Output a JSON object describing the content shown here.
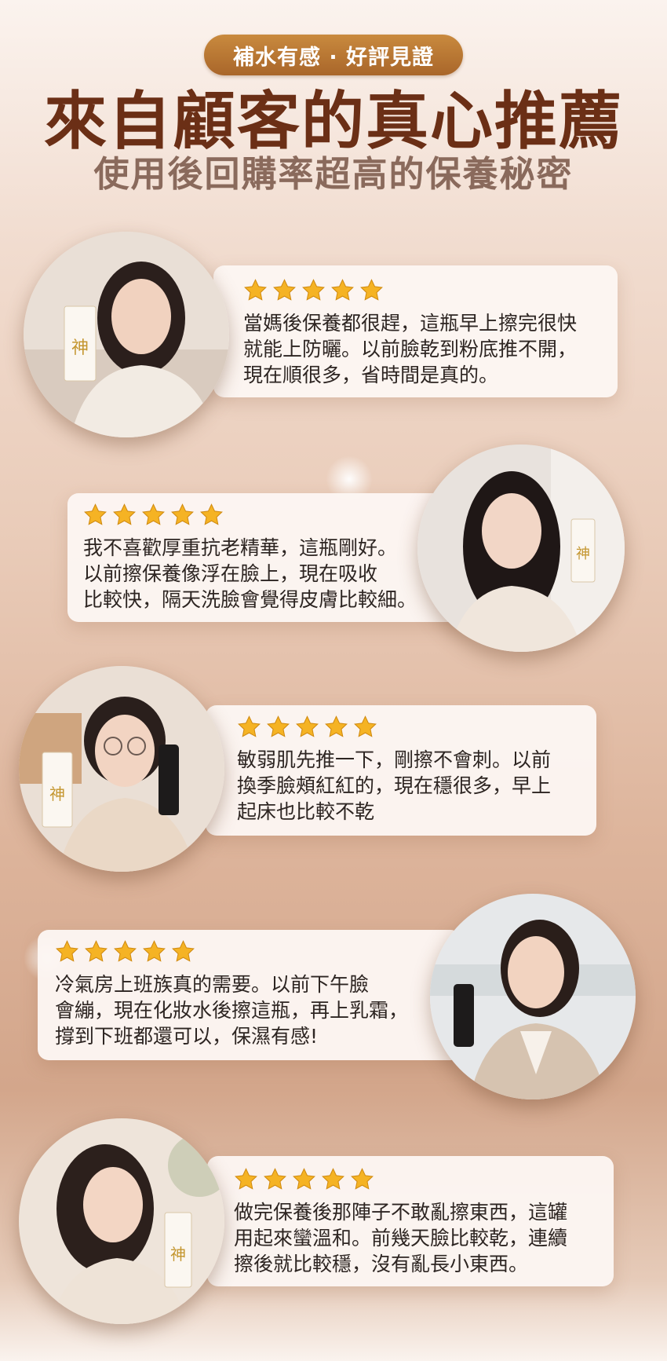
{
  "header": {
    "badge": "補水有感 · 好評見證",
    "title": "來自顧客的真心推薦",
    "subtitle": "使用後回購率超高的保養秘密"
  },
  "colors": {
    "badge_bg": "#b27534",
    "title": "#6b2f16",
    "subtitle": "#8a6a5c",
    "star": "#f5b324",
    "card_bg": "#fcf6f2"
  },
  "reviews": [
    {
      "rating": 5,
      "text": "當媽後保養都很趕，這瓶早上擦完很快\n就能上防曬。以前臉乾到粉底推不開，\n現在順很多，省時間是真的。",
      "avatar_icon": "customer-photo-1"
    },
    {
      "rating": 5,
      "text": "我不喜歡厚重抗老精華，這瓶剛好。\n以前擦保養像浮在臉上，現在吸收\n比較快，隔天洗臉會覺得皮膚比較細。",
      "avatar_icon": "customer-photo-2"
    },
    {
      "rating": 5,
      "text": "敏弱肌先推一下，剛擦不會刺。以前\n換季臉頰紅紅的，現在穩很多，早上\n起床也比較不乾",
      "avatar_icon": "customer-photo-3"
    },
    {
      "rating": 5,
      "text": "冷氣房上班族真的需要。以前下午臉\n會繃，現在化妝水後擦這瓶，再上乳霜，\n撐到下班都還可以，保濕有感!",
      "avatar_icon": "customer-photo-4"
    },
    {
      "rating": 5,
      "text": "做完保養後那陣子不敢亂擦東西，這罐\n用起來蠻溫和。前幾天臉比較乾，連續\n擦後就比較穩，沒有亂長小東西。",
      "avatar_icon": "customer-photo-5"
    }
  ]
}
